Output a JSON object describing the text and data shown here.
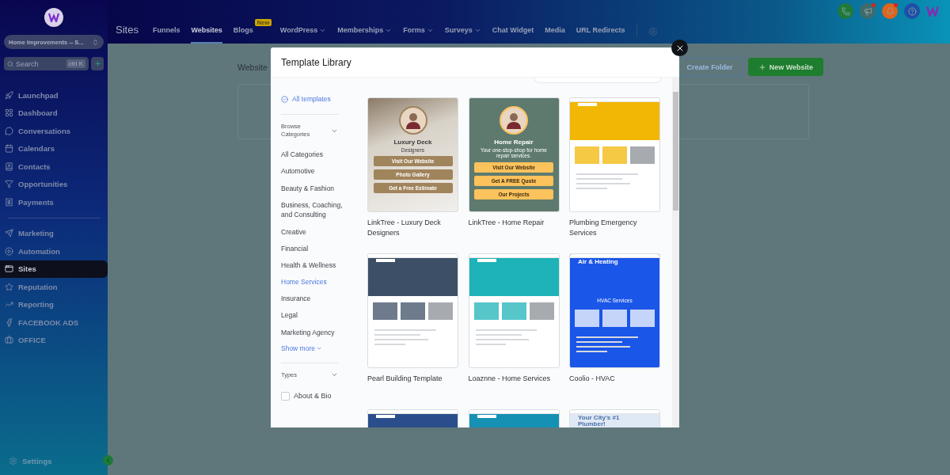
{
  "sidebar": {
    "account": "Home Improvements -- S...",
    "search": {
      "placeholder": "Search",
      "shortcut": "ctrl K"
    },
    "groups": [
      [
        {
          "label": "Launchpad",
          "selected": false
        },
        {
          "label": "Dashboard",
          "selected": false
        },
        {
          "label": "Conversations",
          "selected": false
        },
        {
          "label": "Calendars",
          "selected": false
        },
        {
          "label": "Contacts",
          "selected": false
        },
        {
          "label": "Opportunities",
          "selected": false
        },
        {
          "label": "Payments",
          "selected": false
        }
      ],
      [
        {
          "label": "Marketing",
          "selected": false
        },
        {
          "label": "Automation",
          "selected": false
        },
        {
          "label": "Sites",
          "selected": true
        },
        {
          "label": "Reputation",
          "selected": false
        },
        {
          "label": "Reporting",
          "selected": false
        },
        {
          "label": "FACEBOOK ADS",
          "selected": false
        },
        {
          "label": "OFFICE",
          "selected": false
        }
      ]
    ],
    "settings": "Settings"
  },
  "topbar": {
    "title": "Sites",
    "tabs": [
      {
        "label": "Funnels",
        "selected": false,
        "dropdown": false
      },
      {
        "label": "Websites",
        "selected": true,
        "dropdown": false
      },
      {
        "label": "Blogs",
        "selected": false,
        "dropdown": false,
        "badge": "New"
      },
      {
        "label": "WordPress",
        "selected": false,
        "dropdown": true
      },
      {
        "label": "Memberships",
        "selected": false,
        "dropdown": true
      },
      {
        "label": "Forms",
        "selected": false,
        "dropdown": true
      },
      {
        "label": "Surveys",
        "selected": false,
        "dropdown": true
      },
      {
        "label": "Chat Widget",
        "selected": false,
        "dropdown": false
      },
      {
        "label": "Media",
        "selected": false,
        "dropdown": false
      },
      {
        "label": "URL Redirects",
        "selected": false,
        "dropdown": false
      }
    ],
    "actions": [
      {
        "kind": "phone",
        "alert": false
      },
      {
        "kind": "megaphone",
        "alert": true
      },
      {
        "kind": "bell",
        "alert": true
      },
      {
        "kind": "help",
        "alert": false
      }
    ]
  },
  "page": {
    "heading": "Website",
    "buttons": [
      {
        "label": "Create Folder",
        "kind": "outline"
      },
      {
        "label": "New Website",
        "kind": "primary"
      }
    ]
  },
  "modal": {
    "title": "Template Library",
    "all_templates": "All templates",
    "categories": {
      "heading": "Browse Categories",
      "expanded": true,
      "items": [
        {
          "label": "All Categories",
          "selected": false
        },
        {
          "label": "Automotive",
          "selected": false
        },
        {
          "label": "Beauty & Fashion",
          "selected": false
        },
        {
          "label": "Business, Coaching, and Consulting",
          "selected": false
        },
        {
          "label": "Creative",
          "selected": false
        },
        {
          "label": "Financial",
          "selected": false
        },
        {
          "label": "Health & Wellness",
          "selected": false
        },
        {
          "label": "Home Services",
          "selected": true
        },
        {
          "label": "Insurance",
          "selected": false
        },
        {
          "label": "Legal",
          "selected": false
        },
        {
          "label": "Marketing Agency",
          "selected": false
        }
      ],
      "show_more": "Show more"
    },
    "types": {
      "heading": "Types",
      "expanded": true,
      "items": [
        {
          "label": "About & Bio",
          "checked": false
        }
      ]
    },
    "templates": [
      {
        "name": "LinkTree - Luxury Deck Designers",
        "preview": {
          "kind": "linktree",
          "texts": [
            "Luxury Deck",
            "Designers"
          ],
          "buttons": [
            "Visit Our Website",
            "Photo Gallery",
            "Get a Free Estimate"
          ]
        }
      },
      {
        "name": "LinkTree - Home Repair",
        "preview": {
          "kind": "linktree",
          "texts": [
            "Home Repair",
            "Your one-stop-shop for home repair services."
          ],
          "buttons": [
            "Visit Our Website",
            "Get A FREE Quote",
            "Our Projects"
          ]
        }
      },
      {
        "name": "Plumbing Emergency Services",
        "preview": {
          "kind": "site"
        }
      },
      {
        "name": "Pearl Building Template",
        "preview": {
          "kind": "site"
        }
      },
      {
        "name": "Loaznne - Home Services",
        "preview": {
          "kind": "site"
        }
      },
      {
        "name": "Coolio - HVAC",
        "preview": {
          "kind": "site",
          "texts": [
            "Air & Heating",
            "HVAC Services"
          ]
        }
      },
      {
        "preview": {
          "kind": "site"
        }
      },
      {
        "preview": {
          "kind": "site"
        }
      },
      {
        "preview": {
          "kind": "site",
          "texts": [
            "Your City's #1 Plumber!"
          ]
        }
      }
    ]
  }
}
